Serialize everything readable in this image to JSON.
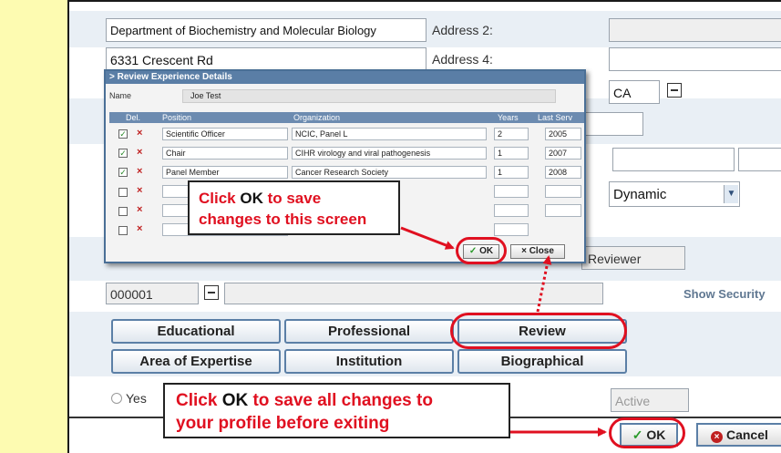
{
  "form": {
    "dept_value": "Department of Biochemistry and Molecular Biology",
    "address2_label": "Address 2:",
    "street_value": "6331 Crescent Rd",
    "address4_label": "Address 4:",
    "province_value": "CA",
    "dropdown_value": "Dynamic",
    "role_value": "Reviewer",
    "code_value": "000001",
    "show_security_label": "Show Security",
    "tabs": {
      "educational": "Educational",
      "professional": "Professional",
      "review": "Review",
      "expertise": "Area of Expertise",
      "institution": "Institution",
      "biographical": "Biographical"
    },
    "yes_label": "Yes",
    "status_value": "Active",
    "ok_label": "OK",
    "cancel_label": "Cancel"
  },
  "dialog": {
    "title": "Review Experience Details",
    "name_label": "Name",
    "name_value": "Joe Test",
    "columns": [
      "Del.",
      "Position",
      "Organization",
      "Years",
      "Last Serv"
    ],
    "rows": [
      {
        "position": "Scientific Officer",
        "organization": "NCIC, Panel L",
        "years": "2",
        "last": "2005"
      },
      {
        "position": "Chair",
        "organization": "CIHR virology and viral pathogenesis",
        "years": "1",
        "last": "2007"
      },
      {
        "position": "Panel Member",
        "organization": "Cancer Research Society",
        "years": "1",
        "last": "2008"
      }
    ],
    "ok_label": "OK",
    "close_label": "Close"
  },
  "callouts": {
    "dialog_line1": [
      "Click ",
      "OK",
      " to save"
    ],
    "dialog_line2": "changes to this screen",
    "page_line1": [
      "Click ",
      "OK",
      " to save all changes to"
    ],
    "page_line2": "your profile before exiting"
  },
  "colors": {
    "accent_red": "#e01020",
    "highlight": "#fdfbb1",
    "button_border": "#5b7fa6"
  }
}
